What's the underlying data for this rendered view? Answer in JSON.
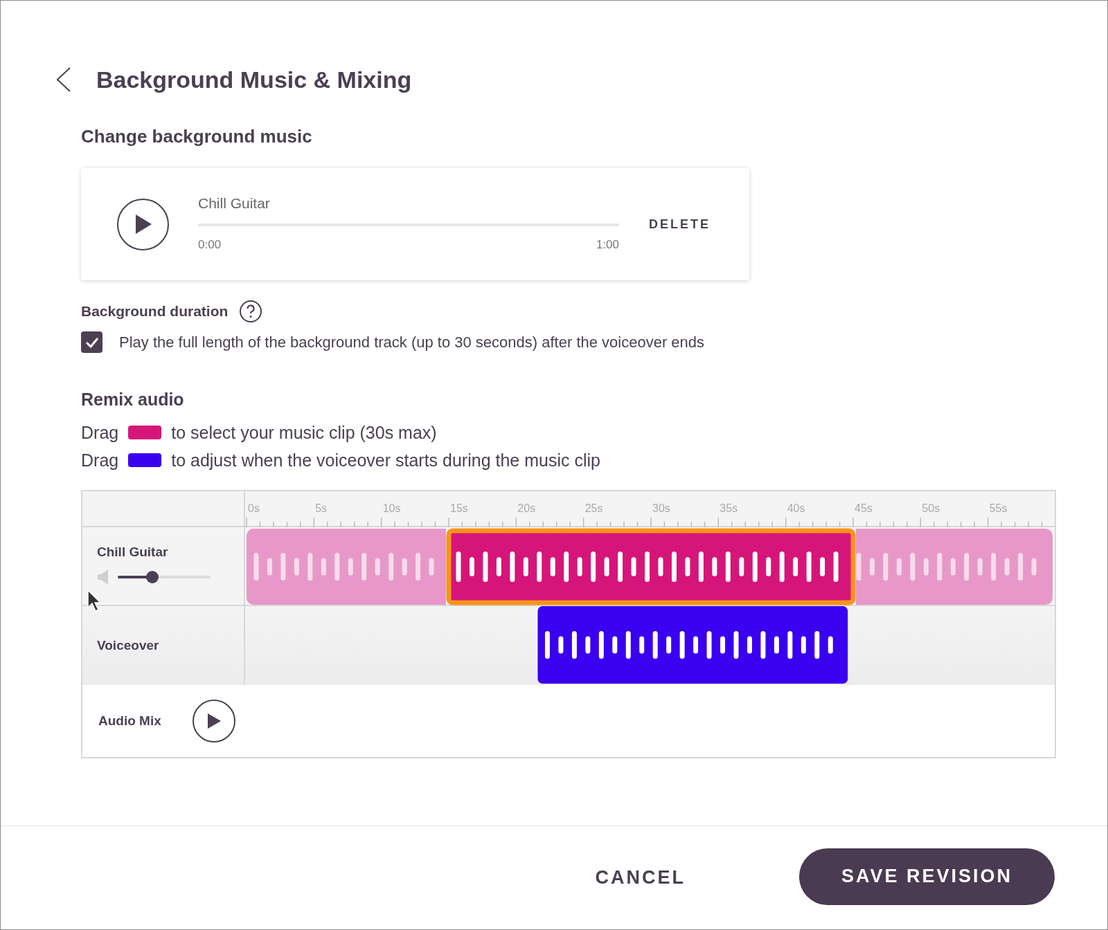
{
  "header": {
    "title": "Background Music & Mixing"
  },
  "music": {
    "heading": "Change background music",
    "track": {
      "name": "Chill Guitar",
      "elapsed": "0:00",
      "duration": "1:00",
      "delete": "DELETE"
    }
  },
  "duration": {
    "label": "Background duration",
    "checkbox": {
      "label": "Play the full length of the background track (up to 30 seconds) after the voiceover ends",
      "checked": true
    }
  },
  "remix": {
    "heading": "Remix audio",
    "legend": [
      {
        "prefix": "Drag",
        "color": "#d6157a",
        "text": "to select your music clip (30s max)"
      },
      {
        "prefix": "Drag",
        "color": "#3a00f0",
        "text": "to adjust when the voiceover starts during the music clip"
      }
    ],
    "timeline": {
      "ticks": [
        "0s",
        "5s",
        "10s",
        "15s",
        "20s",
        "25s",
        "30s",
        "35s",
        "40s",
        "45s",
        "50s",
        "55s"
      ],
      "tracks": [
        {
          "kind": "music",
          "name": "Chill Guitar",
          "color": "#d6157a",
          "volume": {
            "level": 0.33
          }
        },
        {
          "kind": "voice",
          "name": "Voiceover",
          "color": "#3a00f0"
        }
      ],
      "mix": {
        "label": "Audio Mix"
      }
    }
  },
  "actions": [
    {
      "kind": "text",
      "label": "CANCEL"
    },
    {
      "kind": "primary",
      "label": "SAVE REVISION"
    }
  ]
}
